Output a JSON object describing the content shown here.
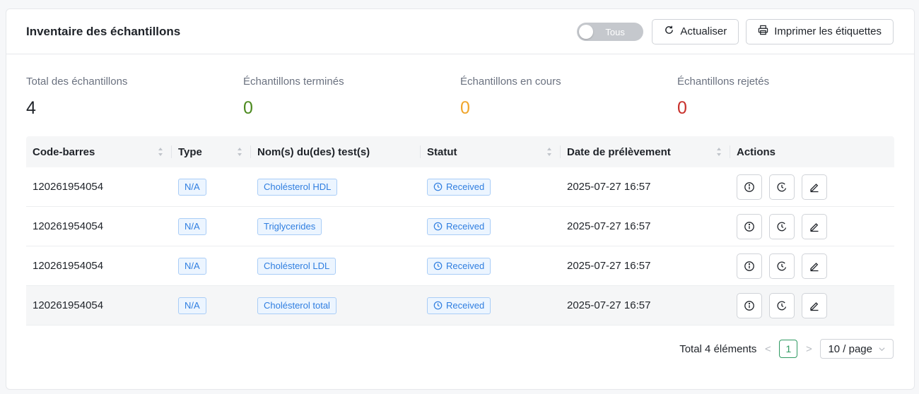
{
  "card": {
    "title": "Inventaire des échantillons"
  },
  "header": {
    "toggle_label": "Tous",
    "refresh_label": "Actualiser",
    "print_label": "Imprimer les étiquettes"
  },
  "stats": [
    {
      "label": "Total des échantillons",
      "value": "4",
      "color": "#1f2329"
    },
    {
      "label": "Échantillons terminés",
      "value": "0",
      "color": "#4c8a1f"
    },
    {
      "label": "Échantillons en cours",
      "value": "0",
      "color": "#f0a52b"
    },
    {
      "label": "Échantillons rejetés",
      "value": "0",
      "color": "#c8302b"
    }
  ],
  "table": {
    "columns": [
      "Code-barres",
      "Type",
      "Nom(s) du(des) test(s)",
      "Statut",
      "Date de prélèvement",
      "Actions"
    ],
    "rows": [
      {
        "barcode": "120261954054",
        "type": "N/A",
        "test": "Cholésterol HDL",
        "status": "Received",
        "date": "2025-07-27 16:57"
      },
      {
        "barcode": "120261954054",
        "type": "N/A",
        "test": "Triglycerides",
        "status": "Received",
        "date": "2025-07-27 16:57"
      },
      {
        "barcode": "120261954054",
        "type": "N/A",
        "test": "Cholésterol LDL",
        "status": "Received",
        "date": "2025-07-27 16:57"
      },
      {
        "barcode": "120261954054",
        "type": "N/A",
        "test": "Cholésterol total",
        "status": "Received",
        "date": "2025-07-27 16:57"
      }
    ]
  },
  "pagination": {
    "total_label": "Total 4 éléments",
    "current_page": "1",
    "page_size": "10 / page"
  },
  "colors": {
    "accent_green": "#2f9a62",
    "tag_blue": "#2f7ee0"
  }
}
